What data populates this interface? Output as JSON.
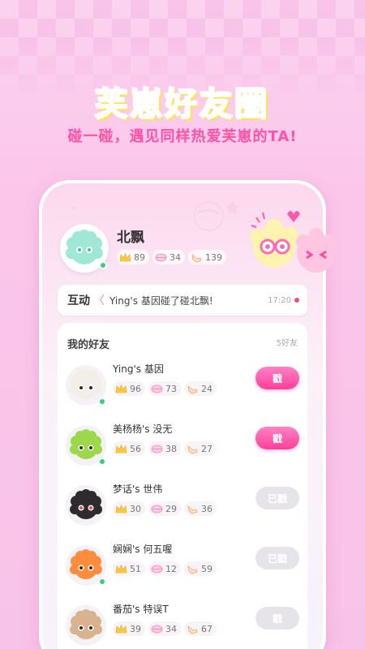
{
  "header": {
    "title": "芙崽好友圈",
    "subtitle": "碰一碰，遇见同样热爱芙崽的TA!"
  },
  "profile": {
    "name": "北飘",
    "stats": [
      "89",
      "34",
      "139"
    ]
  },
  "interaction": {
    "label": "互动",
    "separator": "〈",
    "message": "Ying's 基因碰了碰北飘!",
    "time": "17:20"
  },
  "friends": {
    "header": "我的好友",
    "count": "5好友",
    "items": [
      {
        "name": "Ying's 基因",
        "stats": [
          "96",
          "73",
          "24"
        ],
        "button": "戳",
        "state": "active",
        "color": "#f2efe9",
        "online": true
      },
      {
        "name": "美杨杨's 没无",
        "stats": [
          "56",
          "38",
          "27"
        ],
        "button": "戳",
        "state": "active",
        "color": "#9bd84a",
        "online": true
      },
      {
        "name": "梦话's 世伟",
        "stats": [
          "30",
          "29",
          "36"
        ],
        "button": "已戳",
        "state": "done",
        "color": "#2d2b2e",
        "online": false
      },
      {
        "name": "娴娴's 何五喔",
        "stats": [
          "51",
          "12",
          "59"
        ],
        "button": "已戳",
        "state": "done",
        "color": "#ff8d3d",
        "online": true
      },
      {
        "name": "番茄's 特误T",
        "stats": [
          "39",
          "34",
          "67"
        ],
        "button": "戳",
        "state": "done",
        "color": "#d8b38e",
        "online": false
      }
    ]
  },
  "colors": {
    "accent": "#ff4fa4",
    "online": "#33d27a",
    "crown": "#ffc93c",
    "lips": "#ff9cc6",
    "hand": "#f2b27a"
  },
  "icons": [
    "crown-icon",
    "lips-icon",
    "poke-hand-icon",
    "mascot-image"
  ]
}
